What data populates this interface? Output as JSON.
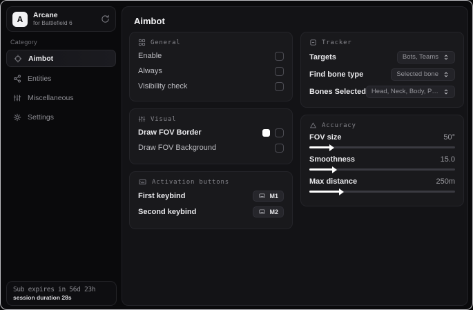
{
  "sidebar": {
    "app": {
      "initial": "A",
      "name": "Arcane",
      "subtitle": "for Battlefield 6"
    },
    "category_label": "Category",
    "items": [
      {
        "label": "Aimbot",
        "selected": true
      },
      {
        "label": "Entities",
        "selected": false
      },
      {
        "label": "Miscellaneous",
        "selected": false
      },
      {
        "label": "Settings",
        "selected": false
      }
    ],
    "subscription": {
      "expires": "Sub expires in 56d 23h",
      "session": "session duration 28s"
    }
  },
  "main": {
    "title": "Aimbot",
    "cards": {
      "general": {
        "title": "General",
        "rows": [
          {
            "label": "Enable",
            "checked": false
          },
          {
            "label": "Always",
            "checked": false
          },
          {
            "label": "Visibility check",
            "checked": false
          }
        ]
      },
      "visual": {
        "title": "Visual",
        "rows": [
          {
            "label": "Draw FOV Border",
            "swatch": "#ffffff",
            "checked": false
          },
          {
            "label": "Draw FOV Background",
            "checked": false
          }
        ]
      },
      "activation": {
        "title": "Activation buttons",
        "rows": [
          {
            "label": "First keybind",
            "key": "M1"
          },
          {
            "label": "Second keybind",
            "key": "M2"
          }
        ]
      },
      "tracker": {
        "title": "Tracker",
        "rows": [
          {
            "label": "Targets",
            "value": "Bots, Teams"
          },
          {
            "label": "Find bone type",
            "value": "Selected bone"
          },
          {
            "label": "Bones Selected",
            "value": "Head, Neck, Body, Pe.."
          }
        ]
      },
      "accuracy": {
        "title": "Accuracy",
        "rows": [
          {
            "label": "FOV size",
            "value": "50°",
            "fill": "14%"
          },
          {
            "label": "Smoothness",
            "value": "15.0",
            "fill": "16%"
          },
          {
            "label": "Max distance",
            "value": "250m",
            "fill": "21%"
          }
        ]
      }
    }
  },
  "colors": {
    "fov_border_swatch": "#ffffff",
    "slider_fill": "#ffffff"
  }
}
